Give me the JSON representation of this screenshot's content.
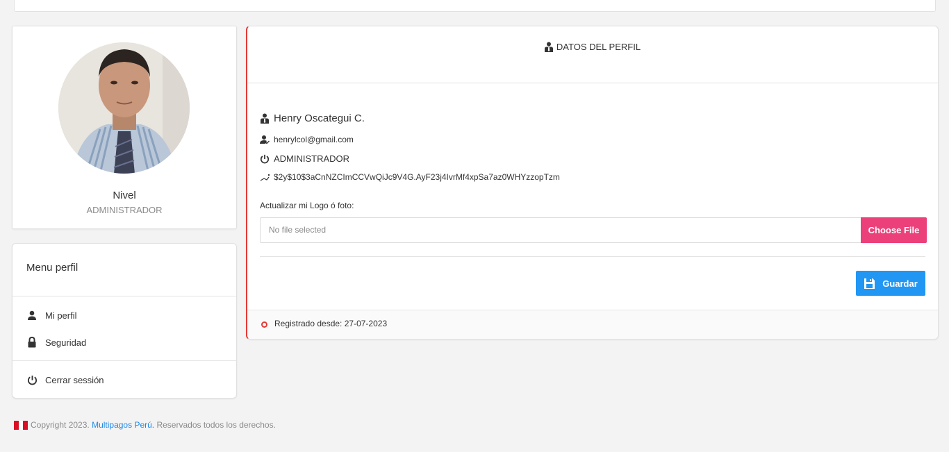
{
  "profile": {
    "level_label": "Nivel",
    "level_value": "ADMINISTRADOR"
  },
  "menu": {
    "title": "Menu perfil",
    "items": [
      {
        "label": "Mi perfil",
        "icon": "user-icon"
      },
      {
        "label": "Seguridad",
        "icon": "lock-icon"
      },
      {
        "label": "Cerrar sessión",
        "icon": "power-icon"
      }
    ]
  },
  "main": {
    "title": "DATOS DEL PERFIL",
    "name": "Henry Oscategui C.",
    "email": "henrylcol@gmail.com",
    "role": "ADMINISTRADOR",
    "hash": "$2y$10$3aCnNZCImCCVwQiJc9V4G.AyF23j4IvrMf4xpSa7az0WHYzzopTzm",
    "upload_label": "Actualizar mi Logo ó foto:",
    "file_placeholder": "No file selected",
    "file_button": "Choose File",
    "save_button": "Guardar",
    "registered": "Registrado desde: 27-07-2023"
  },
  "footer": {
    "prefix": "Copyright 2023.",
    "brand": "Multipagos Perú.",
    "suffix": "Reservados todos los derechos."
  },
  "colors": {
    "accent_red": "#e53935",
    "file_button": "#ec407a",
    "save_button": "#2196f3",
    "link": "#1e88e5"
  }
}
